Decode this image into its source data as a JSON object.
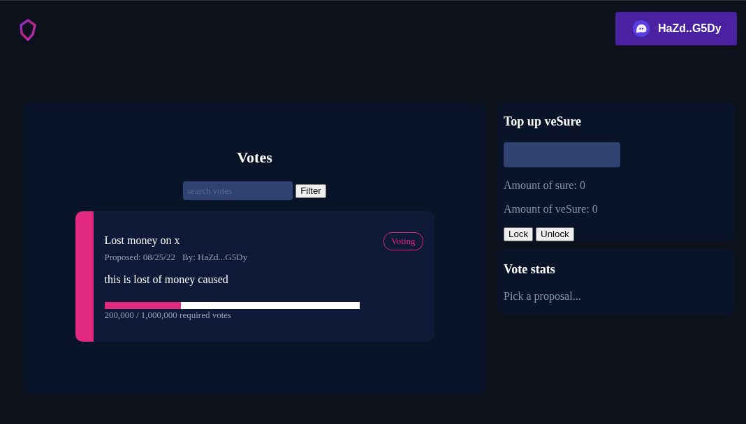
{
  "header": {
    "wallet_button": {
      "label": "HaZd..G5Dy"
    }
  },
  "votes": {
    "title": "Votes",
    "search": {
      "placeholder": "search votes"
    },
    "filter_button": "Filter",
    "proposals": [
      {
        "title": "Lost money on x",
        "proposed": "Proposed: 08/25/22",
        "by": "By: HaZd...G5Dy",
        "status": "Voting",
        "description": "this is lost of money caused",
        "level": 0.3,
        "progress_text": "200,000 / 1,000,000 required votes"
      }
    ]
  },
  "top_up": {
    "title": "Top up veSure",
    "lines": [
      "Amount of sure: 0",
      "Amount of veSure: 0"
    ],
    "buttons": [
      "Lock",
      "Unlock"
    ]
  },
  "vote_stats": {
    "title": "Vote stats",
    "text": "Pick a proposal..."
  }
}
